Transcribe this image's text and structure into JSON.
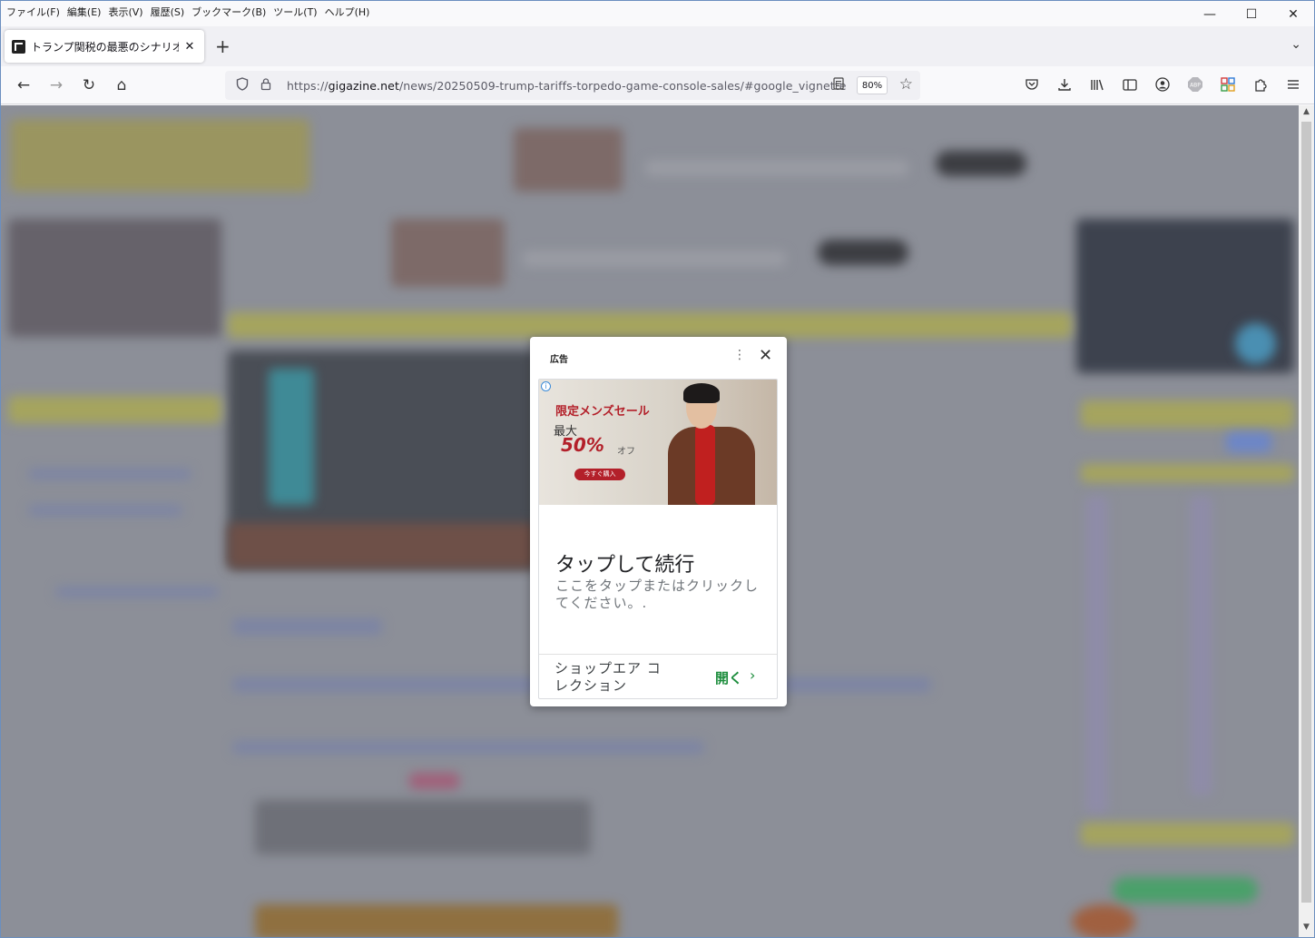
{
  "menu": [
    "ファイル(F)",
    "編集(E)",
    "表示(V)",
    "履歴(S)",
    "ブックマーク(B)",
    "ツール(T)",
    "ヘルプ(H)"
  ],
  "window_controls": {
    "minimize": "—",
    "maximize": "☐",
    "close": "✕"
  },
  "tab": {
    "title": "トランプ関税の最悪のシナリオは「ゲ",
    "close": "✕"
  },
  "newtab": "+",
  "tablist": "⌄",
  "nav": {
    "back": "←",
    "forward": "→",
    "reload": "↻",
    "home": "⌂"
  },
  "url": {
    "prefix": "https://",
    "domain": "gigazine.net",
    "path": "/news/20250509-trump-tariffs-torpedo-game-console-sales/#google_vignette"
  },
  "zoom": "80%",
  "ad": {
    "label": "広告",
    "menu_icon": "⋮",
    "close_icon": "✕",
    "info_icon": "i",
    "banner": {
      "line1": "限定メンズセール",
      "line2": "最大",
      "line3": "50%",
      "line4": "オフ",
      "button": "今すぐ購入"
    },
    "headline": "タップして続行",
    "description": "ここをタップまたはクリックしてください。.",
    "brand": "ショップエア コレクション",
    "open": "開く",
    "chevron": "›"
  },
  "colors": {
    "accent_green": "#1e8e3e",
    "sale_red": "#b3202a",
    "overlay": "#8c8f98"
  }
}
